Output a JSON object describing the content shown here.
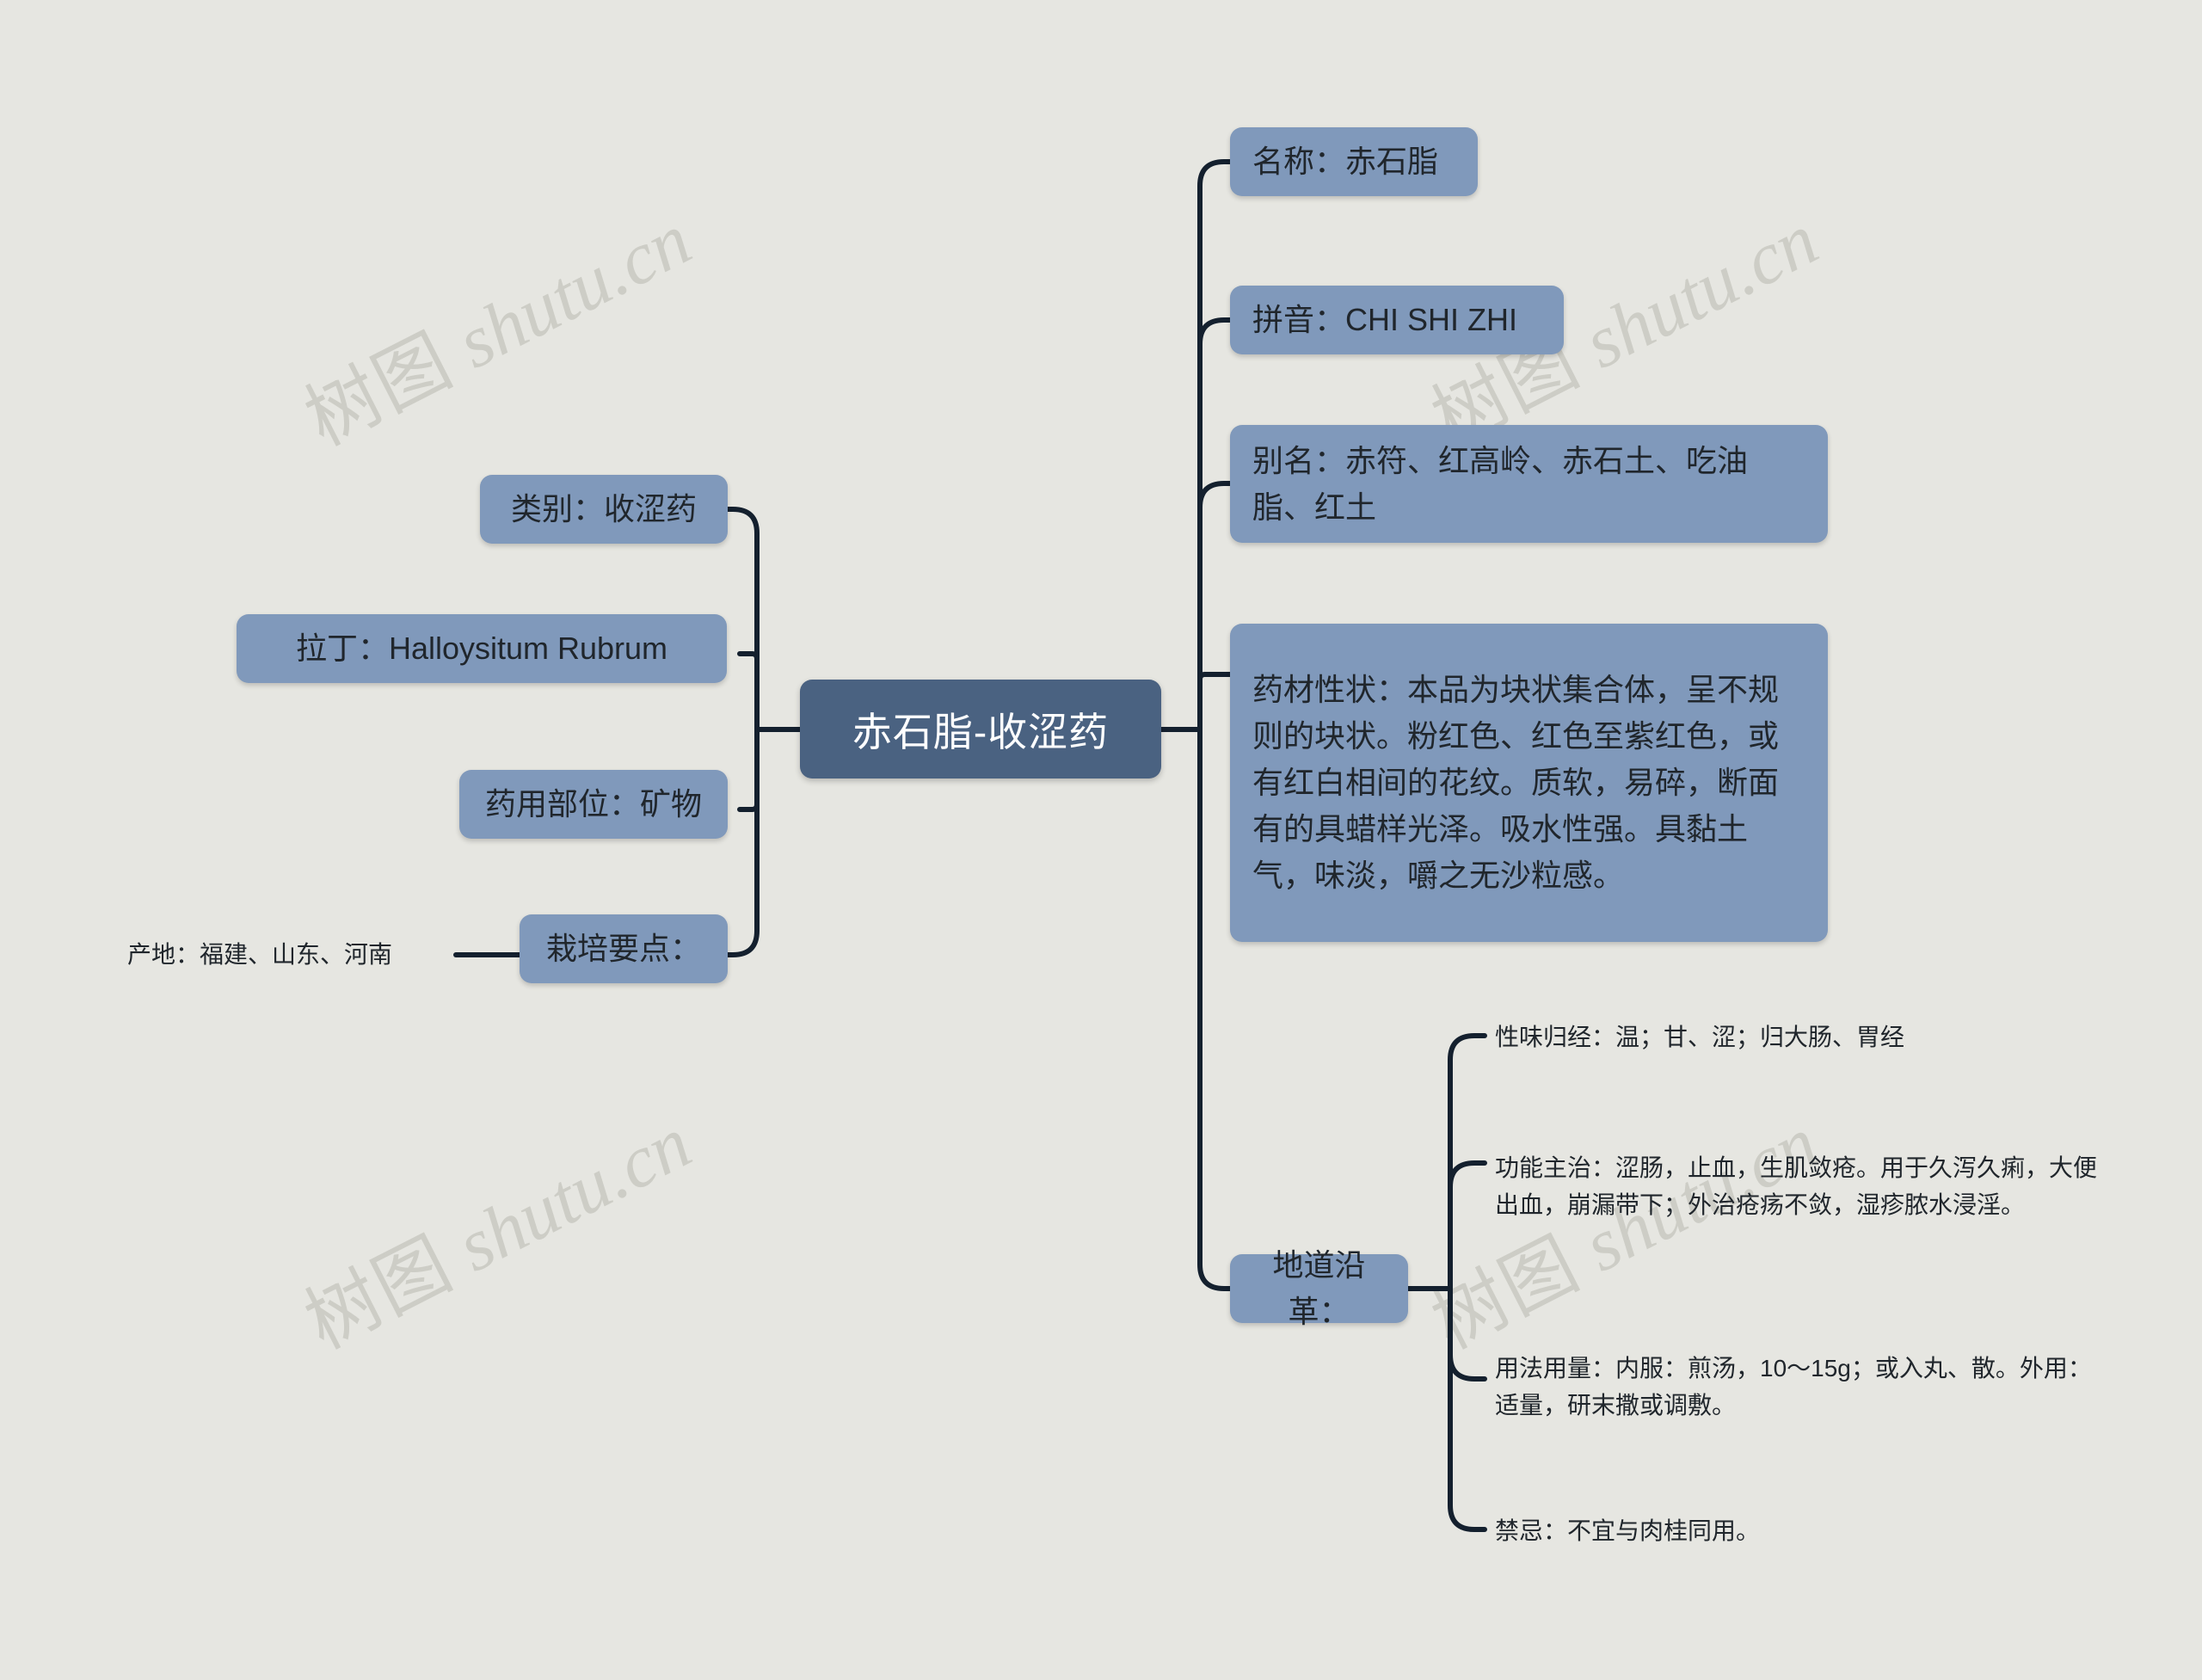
{
  "meta": {
    "background_color": "#e6e6e1",
    "root_color": "#4a6281",
    "branch_color": "#8099bb",
    "line_color": "#14202e",
    "text_color": "#20262c"
  },
  "watermark": {
    "text": "树图 shutu.cn",
    "cjk": "树图",
    "latin": " shutu.cn"
  },
  "root": {
    "label": "赤石脂-收涩药"
  },
  "left_branches": [
    {
      "label": "类别：收涩药"
    },
    {
      "label": "拉丁：Halloysitum Rubrum"
    },
    {
      "label": "药用部位：矿物"
    },
    {
      "label": "栽培要点："
    }
  ],
  "left_leaves": [
    {
      "label": "产地：福建、山东、河南"
    }
  ],
  "right_branches": [
    {
      "label": "名称：赤石脂"
    },
    {
      "label": "拼音：CHI SHI ZHI"
    },
    {
      "label": "别名：赤符、红高岭、赤石土、吃油脂、红土"
    },
    {
      "label": "药材性状：本品为块状集合体，呈不规则的块状。粉红色、红色至紫红色，或有红白相间的花纹。质软，易碎，断面有的具蜡样光泽。吸水性强。具黏土气，味淡，嚼之无沙粒感。"
    },
    {
      "label": "地道沿革："
    }
  ],
  "right_leaves": [
    {
      "label": "性味归经：温；甘、涩；归大肠、胃经"
    },
    {
      "label": "功能主治：涩肠，止血，生肌敛疮。用于久泻久痢，大便出血，崩漏带下；外治疮疡不敛，湿疹脓水浸淫。"
    },
    {
      "label": "用法用量：内服：煎汤，10～15g；或入丸、散。外用：适量，研末撒或调敷。"
    },
    {
      "label": "禁忌：不宜与肉桂同用。"
    }
  ]
}
